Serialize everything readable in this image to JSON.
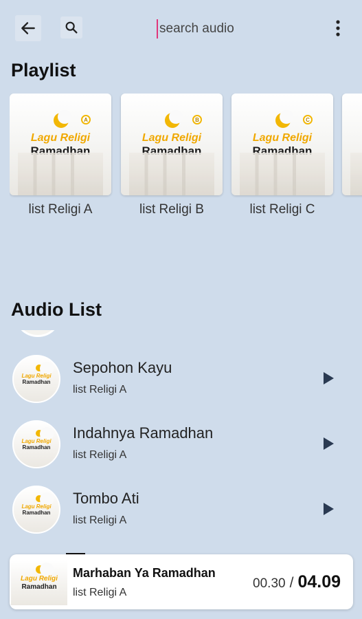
{
  "toolbar": {
    "back_icon": "arrow-left-icon",
    "search_icon": "search-icon",
    "search_placeholder": "search audio",
    "more_icon": "more-vertical-icon"
  },
  "playlist": {
    "title": "Playlist",
    "items": [
      {
        "label": "list Religi A",
        "cover_line1": "Lagu Religi",
        "cover_line2": "Ramadhan",
        "badge": "A"
      },
      {
        "label": "list Religi B",
        "cover_line1": "Lagu Religi",
        "cover_line2": "Ramadhan",
        "badge": "B"
      },
      {
        "label": "list Religi C",
        "cover_line1": "Lagu Religi",
        "cover_line2": "Ramadhan",
        "badge": "C"
      }
    ]
  },
  "audio_list": {
    "title": "Audio List",
    "items": [
      {
        "title": "Sepohon Kayu",
        "playlist": "list Religi A",
        "thumb_line1": "Lagu Religi",
        "thumb_line2": "Ramadhan"
      },
      {
        "title": "Indahnya Ramadhan",
        "playlist": "list Religi A",
        "thumb_line1": "Lagu Religi",
        "thumb_line2": "Ramadhan"
      },
      {
        "title": "Tombo Ati",
        "playlist": "list Religi A",
        "thumb_line1": "Lagu Religi",
        "thumb_line2": "Ramadhan"
      }
    ]
  },
  "now_playing": {
    "title": "Marhaban Ya Ramadhan",
    "playlist": "list Religi A",
    "current_time": "00.30",
    "separator": "/",
    "total_time": "04.09",
    "thumb_line1": "Lagu Religi",
    "thumb_line2": "Ramadhan"
  },
  "colors": {
    "background": "#cfdceb",
    "accent_gold": "#f0a800",
    "cursor_pink": "#e0367a"
  }
}
